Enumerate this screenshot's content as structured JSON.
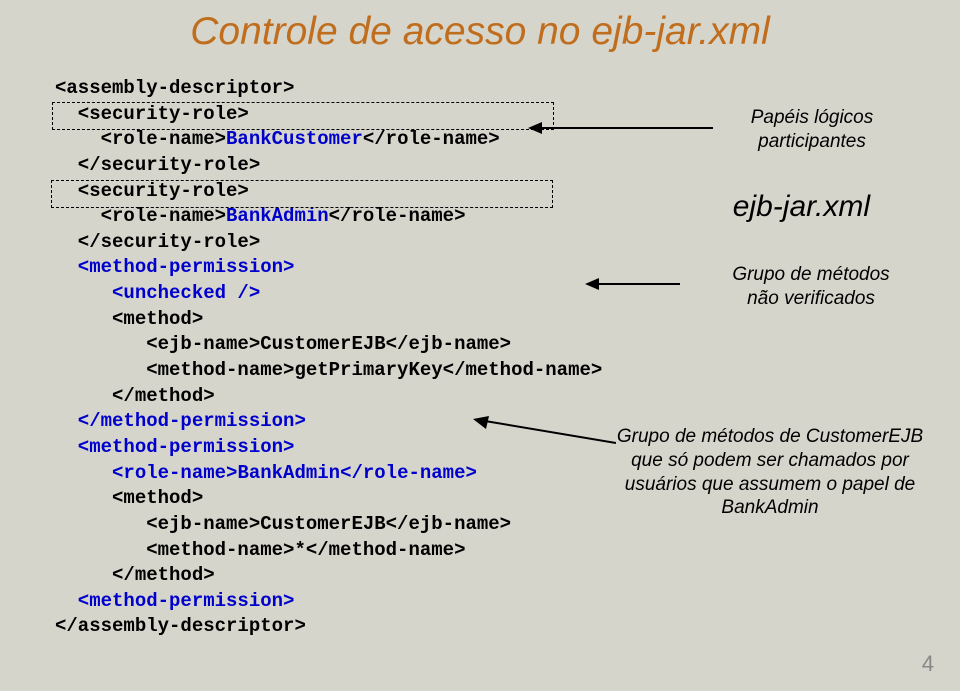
{
  "title": "Controle de acesso no ejb-jar.xml",
  "code": {
    "l01": "<assembly-descriptor>",
    "l02": "  <security-role>",
    "l03a": "    <role-name>",
    "l03b": "BankCustomer",
    "l03c": "</role-name>",
    "l04": "  </security-role>",
    "l05": "  <security-role>",
    "l06a": "    <role-name>",
    "l06b": "BankAdmin",
    "l06c": "</role-name>",
    "l07": "  </security-role>",
    "l08": "  <method-permission>",
    "l09": "     <unchecked />",
    "l10": "     <method>",
    "l11": "        <ejb-name>CustomerEJB</ejb-name>",
    "l12": "        <method-name>getPrimaryKey</method-name>",
    "l13": "     </method>",
    "l14": "  </method-permission>",
    "l15": "  <method-permission>",
    "l16a": "     <role-name>",
    "l16b": "BankAdmin",
    "l16c": "</role-name>",
    "l17": "     <method>",
    "l18": "        <ejb-name>CustomerEJB</ejb-name>",
    "l19": "        <method-name>*</method-name>",
    "l20": "     </method>",
    "l21": "  <method-permission>",
    "l22": "</assembly-descriptor>"
  },
  "annotations": {
    "a1": "Papéis lógicos participantes",
    "a2": "ejb-jar.xml",
    "a3": "Grupo de métodos não verificados",
    "a4": "Grupo de métodos de CustomerEJB que só podem ser chamados por usuários que assumem o papel de BankAdmin"
  },
  "page_number": "4"
}
